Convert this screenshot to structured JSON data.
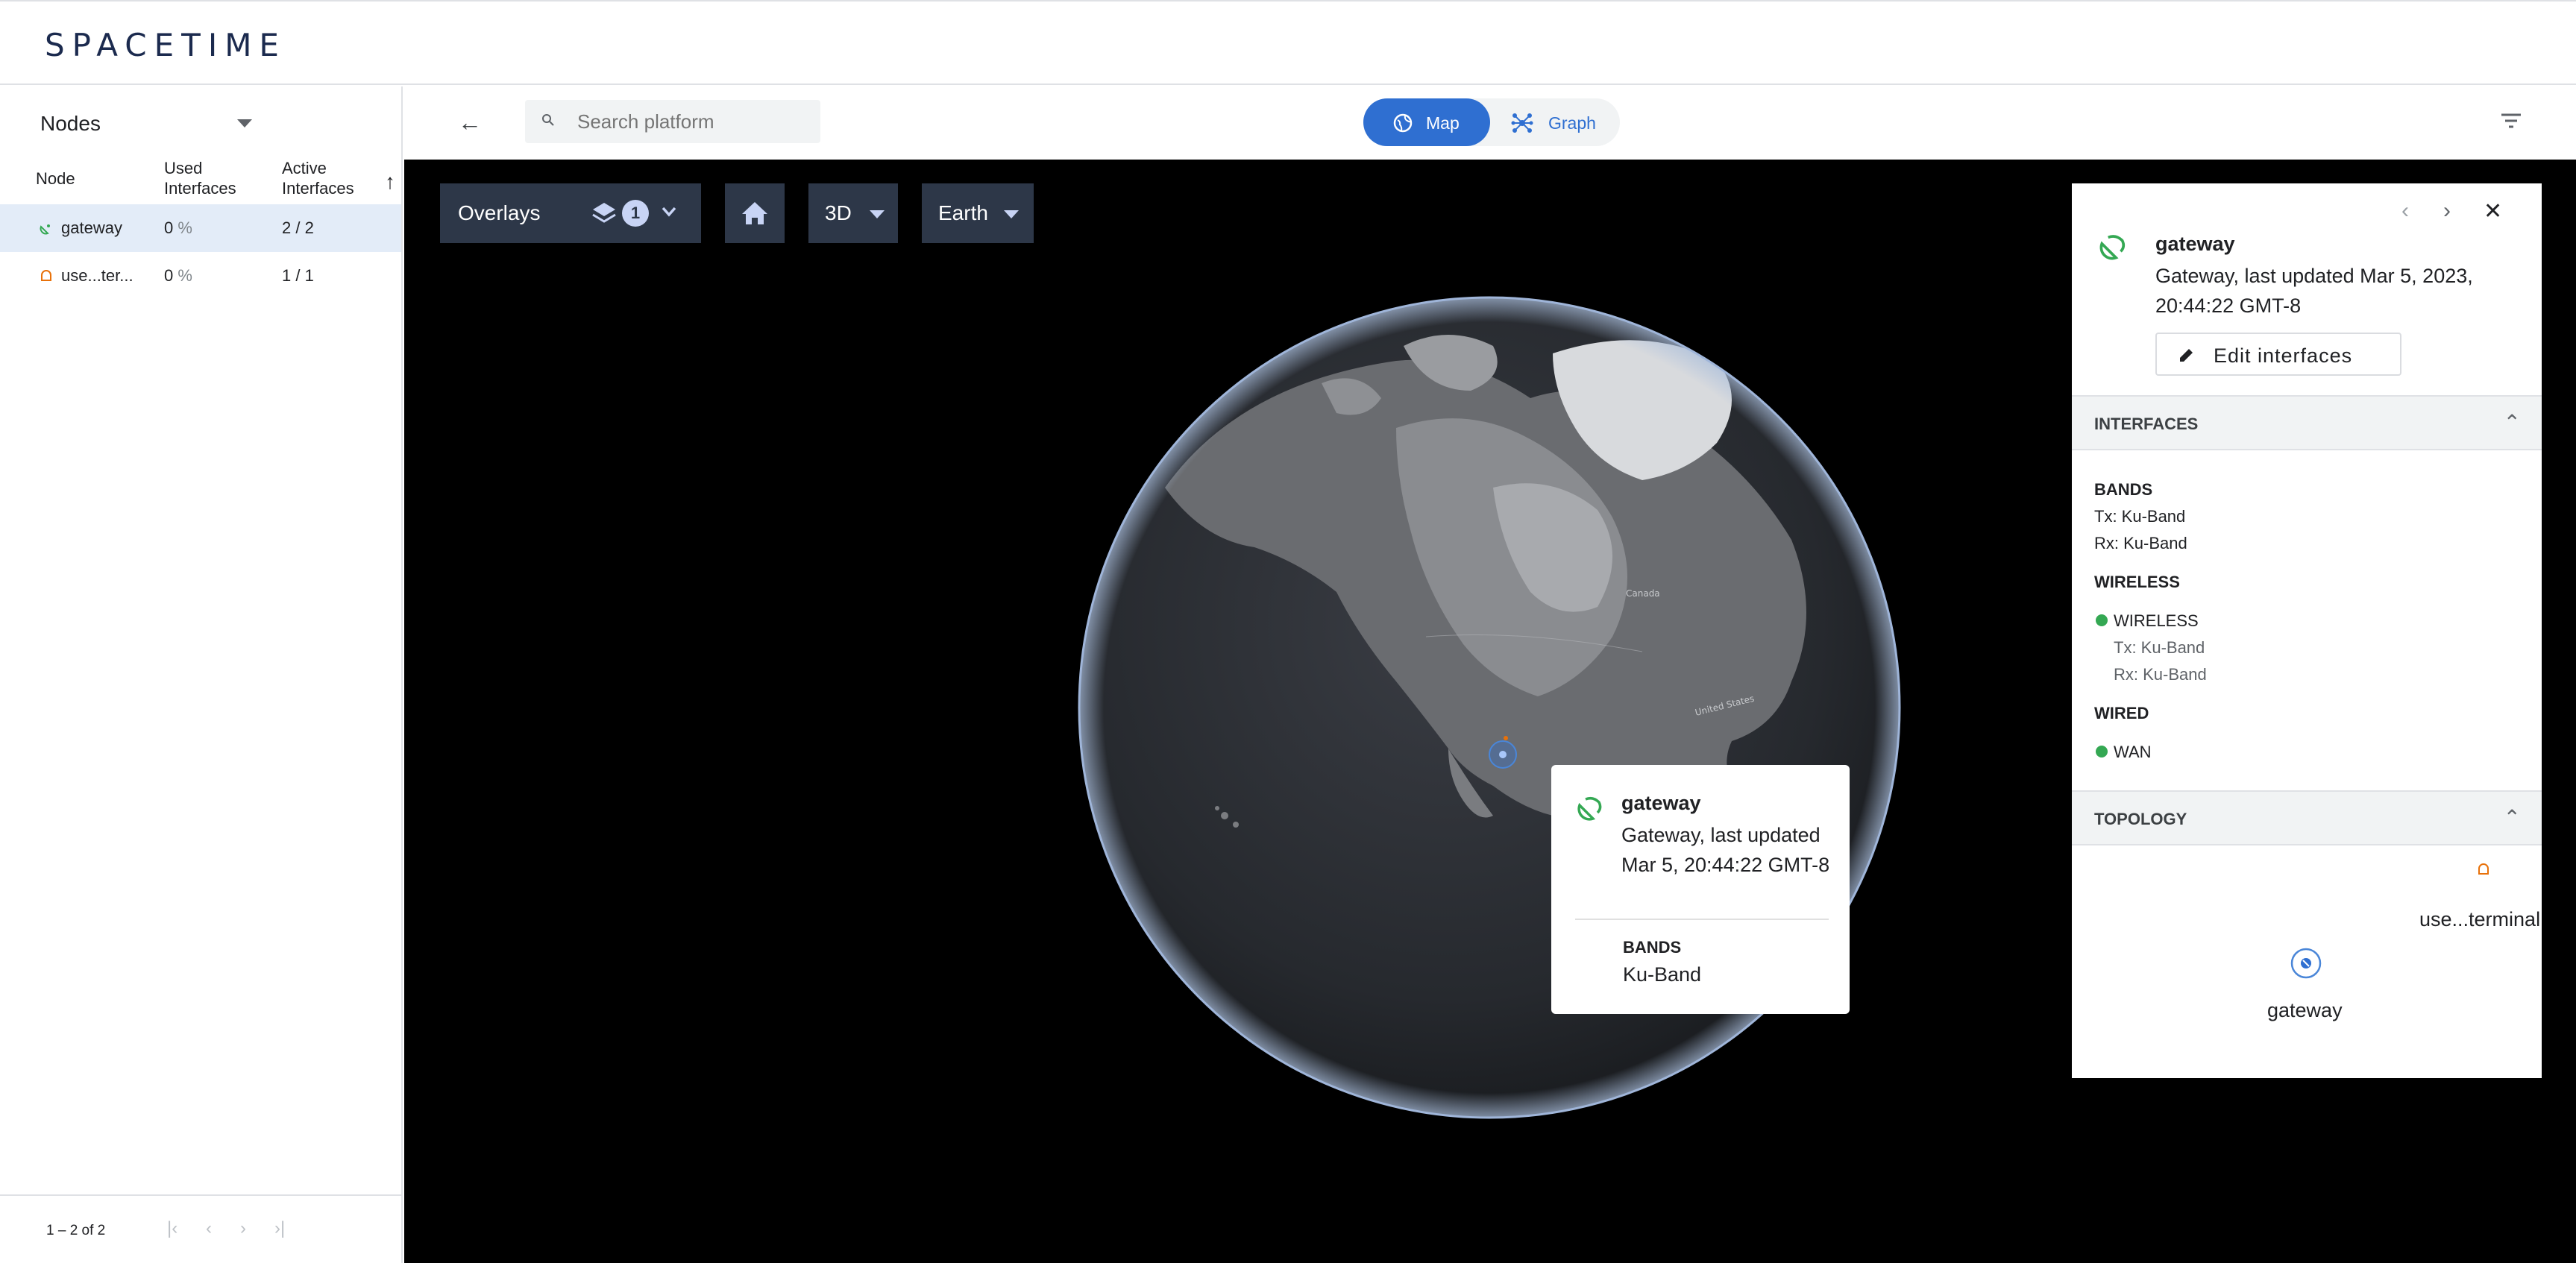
{
  "header": {
    "logo": "SPACETIME"
  },
  "sidebar": {
    "title": "Nodes",
    "columns": [
      "Node",
      "Used Interfaces",
      "Active Interfaces"
    ],
    "rows": [
      {
        "name": "gateway",
        "used": "0",
        "used_unit": "%",
        "active": "2 / 2",
        "icon": "gateway-dish-icon",
        "color": "#34a853"
      },
      {
        "name": "use...ter...",
        "used": "0",
        "used_unit": "%",
        "active": "1 / 1",
        "icon": "user-terminal-icon",
        "color": "#e8710a"
      }
    ],
    "paginator": {
      "range": "1 – 2 of 2"
    }
  },
  "toolbar": {
    "search_placeholder": "Search platform",
    "map_label": "Map",
    "graph_label": "Graph"
  },
  "map_controls": {
    "overlays_label": "Overlays",
    "overlays_count": "1",
    "mode_label": "3D",
    "body_label": "Earth"
  },
  "globe_labels": {
    "canada": "Canada",
    "united_states": "United States"
  },
  "popup": {
    "title": "gateway",
    "subtitle": "Gateway, last updated Mar 5, 20:44:22 GMT-8",
    "bands_label": "BANDS",
    "bands_value": "Ku-Band"
  },
  "panel": {
    "title": "gateway",
    "subtitle": "Gateway, last updated Mar 5, 2023, 20:44:22 GMT-8",
    "edit_label": "Edit interfaces",
    "interfaces_header": "INTERFACES",
    "bands_label": "BANDS",
    "bands_tx": "Tx: Ku-Band",
    "bands_rx": "Rx: Ku-Band",
    "wireless_label": "WIRELESS",
    "wireless_item": "WIRELESS",
    "wireless_tx": "Tx: Ku-Band",
    "wireless_rx": "Rx: Ku-Band",
    "wired_label": "WIRED",
    "wired_item": "WAN",
    "topology_header": "TOPOLOGY",
    "topology_terminal": "use...terminal",
    "topology_gateway": "gateway"
  },
  "colors": {
    "accent": "#2f6fd1",
    "status_green": "#34a853",
    "terminal_orange": "#e8710a",
    "map_control_bg": "#2d3748"
  }
}
